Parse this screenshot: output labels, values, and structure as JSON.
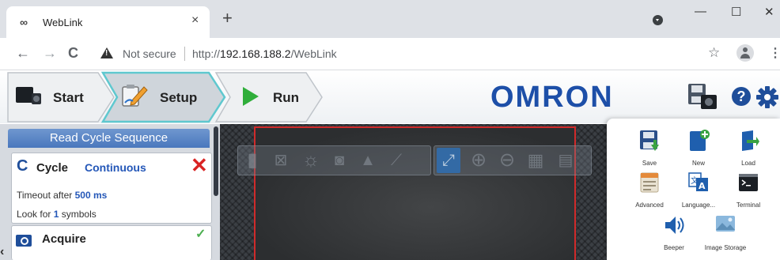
{
  "browser": {
    "tab_title": "WebLink",
    "tab_favicon": "link-icon",
    "tab_close": "×",
    "new_tab": "+",
    "window_controls": {
      "minimize": "—",
      "maximize": "☐",
      "close": "✕"
    },
    "nav": {
      "back": "←",
      "forward": "→",
      "reload": "C"
    },
    "security_label": "Not secure",
    "url_scheme": "http://",
    "url_host": "192.168.188.2",
    "url_path": "/WebLink",
    "star": "☆",
    "menu": "⋮"
  },
  "app_header": {
    "steps": [
      {
        "label": "Start",
        "icon": "camera-icon"
      },
      {
        "label": "Setup",
        "icon": "setup-pencil-icon",
        "active": true
      },
      {
        "label": "Run",
        "icon": "play-icon"
      }
    ],
    "brand": "OMRON",
    "brand_color": "#1d4fa8",
    "accent_color": "#5fc8cf",
    "icons": [
      "save-camera-icon",
      "help-icon",
      "gear-icon"
    ],
    "help_glyph": "?"
  },
  "read_cycle": {
    "title": "Read Cycle Sequence",
    "cycle": {
      "label": "Cycle",
      "mode": "Continuous",
      "remove_glyph": "✕",
      "timeout_prefix": "Timeout after ",
      "timeout_value": "500 ms",
      "look_prefix": "Look for ",
      "look_value": "1",
      "look_suffix": " symbols"
    },
    "acquire": {
      "label": "Acquire",
      "check_glyph": "✓"
    },
    "collapse_glyph": "‹"
  },
  "viewer": {
    "tools": [
      "panel-toggle-icon",
      "roi-icon",
      "brightness-icon",
      "photo-icon",
      "learn-icon",
      "chart-icon",
      "fit-screen-icon",
      "zoom-in-icon",
      "zoom-out-icon",
      "grid-icon",
      "save-image-icon"
    ],
    "active_tool": "fit-screen-icon"
  },
  "menu": {
    "items": [
      {
        "label": "Save",
        "icon": "save-icon"
      },
      {
        "label": "New",
        "icon": "new-file-icon"
      },
      {
        "label": "Load",
        "icon": "load-icon"
      },
      {
        "label": "Advanced",
        "icon": "advanced-icon"
      },
      {
        "label": "Language...",
        "icon": "language-icon"
      },
      {
        "label": "Terminal",
        "icon": "terminal-icon"
      },
      {
        "label": "Beeper",
        "icon": "speaker-icon"
      },
      {
        "label": "Image Storage",
        "icon": "image-storage-icon"
      }
    ]
  }
}
